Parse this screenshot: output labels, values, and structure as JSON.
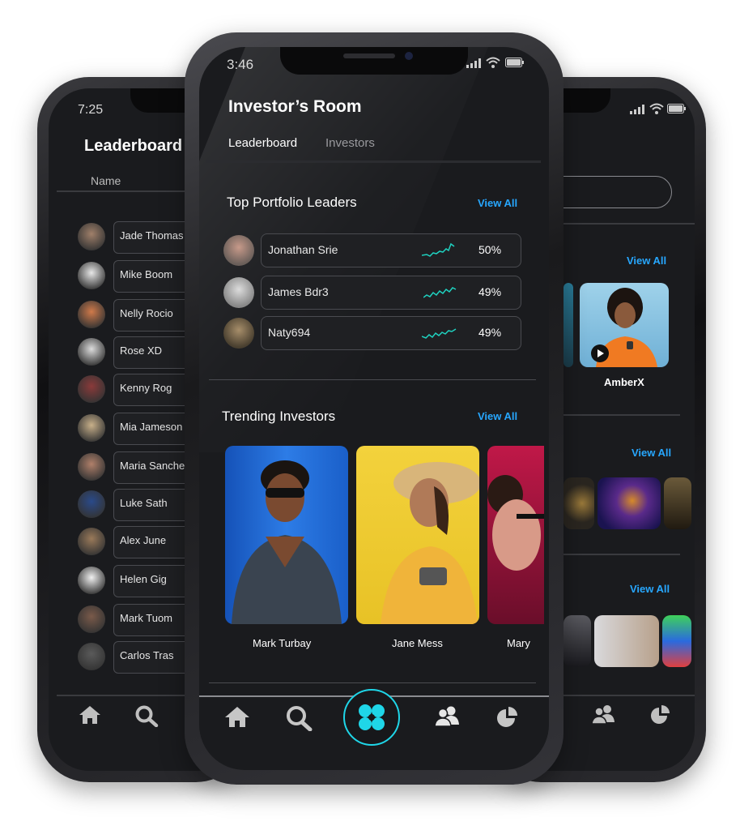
{
  "left_phone": {
    "time": "7:25",
    "title": "Leaderboard",
    "column_header": "Name",
    "rows": [
      {
        "name": "Jade Thomas"
      },
      {
        "name": "Mike Boom"
      },
      {
        "name": "Nelly Rocio"
      },
      {
        "name": "Rose XD"
      },
      {
        "name": "Kenny Rog"
      },
      {
        "name": "Mia Jameson"
      },
      {
        "name": "Maria Sanche"
      },
      {
        "name": "Luke Sath"
      },
      {
        "name": "Alex June"
      },
      {
        "name": "Helen Gig"
      },
      {
        "name": "Mark Tuom"
      },
      {
        "name": "Carlos Tras"
      }
    ]
  },
  "center_phone": {
    "time": "3:46",
    "title": "Investor’s Room",
    "tabs": [
      {
        "label": "Leaderboard",
        "active": true
      },
      {
        "label": "Investors",
        "active": false
      }
    ],
    "portfolio": {
      "heading": "Top Portfolio Leaders",
      "view_all": "View All",
      "leaders": [
        {
          "name": "Jonathan Srie",
          "percent": "50%"
        },
        {
          "name": "James Bdr3",
          "percent": "49%"
        },
        {
          "name": "Naty694",
          "percent": "49%"
        }
      ]
    },
    "trending": {
      "heading": "Trending Investors",
      "view_all": "View All",
      "investors": [
        {
          "name": "Mark Turbay"
        },
        {
          "name": "Jane Mess"
        },
        {
          "name": "Mary"
        }
      ]
    },
    "nav": [
      {
        "icon": "home-icon"
      },
      {
        "icon": "search-icon"
      },
      {
        "icon": "clover-icon"
      },
      {
        "icon": "users-icon"
      },
      {
        "icon": "pie-chart-icon"
      }
    ]
  },
  "right_phone": {
    "view_all_1": "View All",
    "featured_name": "AmberX",
    "view_all_2": "View All",
    "view_all_3": "View All"
  },
  "colors": {
    "accent": "#27a7ff",
    "sparkline": "#1fd2c0",
    "nav_center": "#1fd6e8",
    "screen_bg": "#1a1b1e"
  }
}
